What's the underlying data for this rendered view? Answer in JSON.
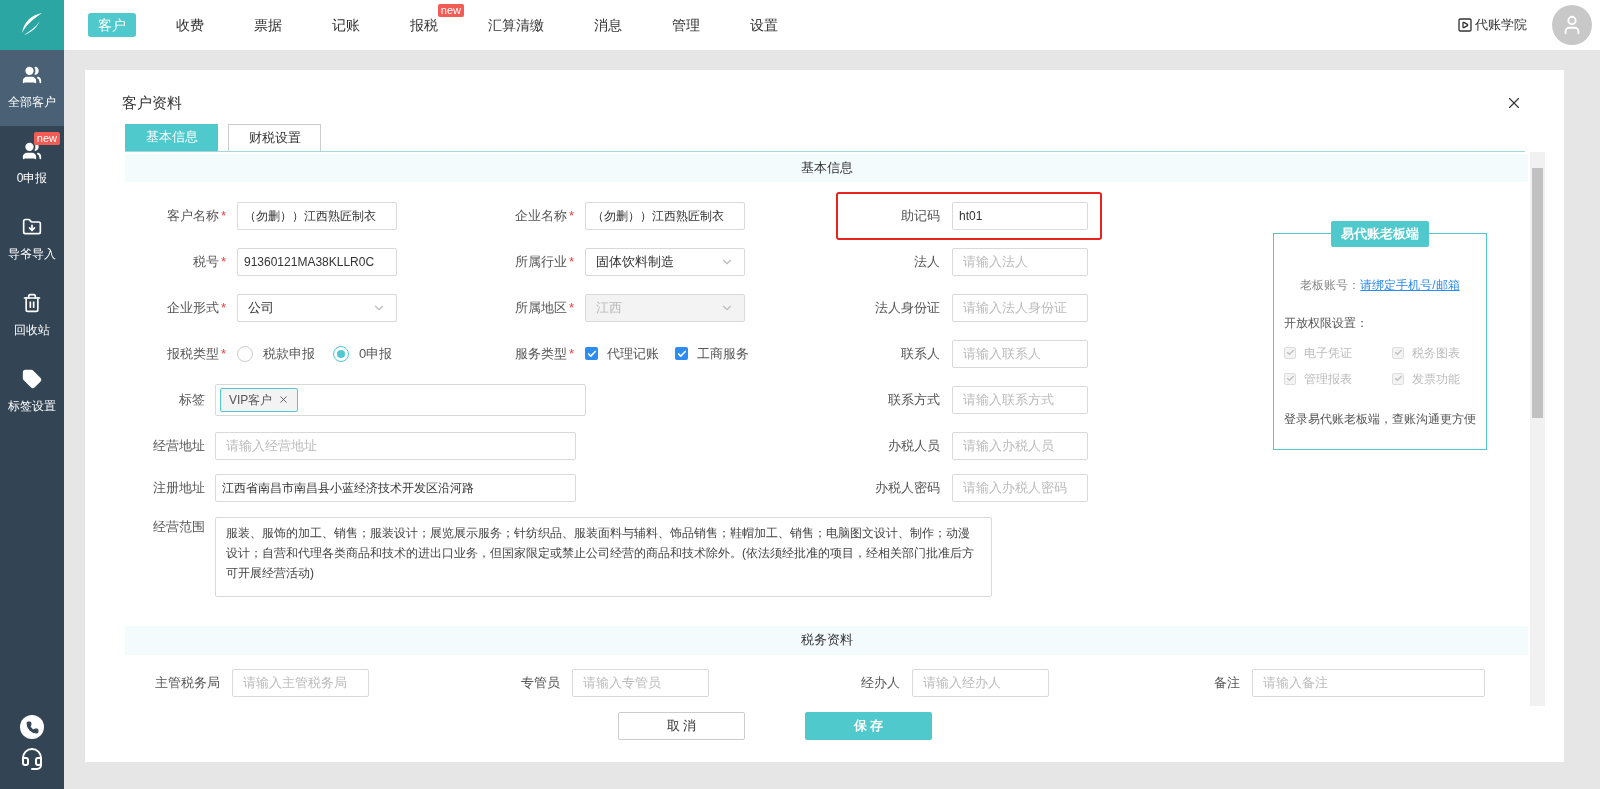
{
  "nav": {
    "items": [
      {
        "label": "客户",
        "selected": true
      },
      {
        "label": "收费",
        "selected": false
      },
      {
        "label": "票据",
        "selected": false
      },
      {
        "label": "记账",
        "selected": false
      },
      {
        "label": "报税",
        "selected": false,
        "badge": "new"
      },
      {
        "label": "汇算清缴",
        "selected": false
      },
      {
        "label": "消息",
        "selected": false
      },
      {
        "label": "管理",
        "selected": false
      },
      {
        "label": "设置",
        "selected": false
      }
    ],
    "academy": "代账学院"
  },
  "sidebar": {
    "items": [
      {
        "kind": "users",
        "label": "全部客户",
        "selected": true
      },
      {
        "kind": "users",
        "label": "0申报",
        "selected": false,
        "badge": "new"
      },
      {
        "kind": "import",
        "label": "导爷导入",
        "selected": false
      },
      {
        "kind": "trash",
        "label": "回收站",
        "selected": false
      },
      {
        "kind": "tag",
        "label": "标签设置",
        "selected": false
      }
    ]
  },
  "modal": {
    "title": "客户资料",
    "tabs": [
      {
        "label": "基本信息",
        "selected": true
      },
      {
        "label": "财税设置",
        "selected": false
      }
    ],
    "basic_section": "基本信息",
    "rows": [
      {
        "fields": [
          {
            "kind": "text",
            "label": "客户名称",
            "marker": "*",
            "value": "（勿删））江西熟匠制衣"
          },
          {
            "kind": "text",
            "label": "企业名称",
            "marker": "*",
            "value": "（勿删））江西熟匠制衣"
          },
          {
            "kind": "text",
            "label": "助记码",
            "value": "ht01",
            "highlighted": true
          }
        ]
      },
      {
        "fields": [
          {
            "kind": "text",
            "label": "税号",
            "marker": "*",
            "value": "91360121MA38KLLR0C"
          },
          {
            "kind": "select",
            "label": "所属行业",
            "marker": "*",
            "value": "固体饮料制造",
            "disabled": false
          },
          {
            "kind": "text",
            "label": "法人",
            "placeholder": "请输入法人"
          }
        ]
      },
      {
        "fields": [
          {
            "kind": "select",
            "label": "企业形式",
            "marker": "*",
            "value": "公司",
            "disabled": false
          },
          {
            "kind": "select",
            "label": "所属地区",
            "marker": "*",
            "value": "江西",
            "disabled": true
          },
          {
            "kind": "text",
            "label": "法人身份证",
            "placeholder": "请输入法人身份证"
          }
        ]
      },
      {
        "fields": [
          {
            "kind": "radio",
            "label": "报税类型",
            "marker": "*",
            "options": [
              {
                "label": "税款申报",
                "selected": false
              },
              {
                "label": "0申报",
                "selected": true
              }
            ]
          },
          {
            "kind": "checkbox",
            "label": "服务类型",
            "marker": "*",
            "options": [
              {
                "label": "代理记账",
                "checked": true
              },
              {
                "label": "工商服务",
                "checked": true
              }
            ]
          },
          {
            "kind": "text",
            "label": "联系人",
            "placeholder": "请输入联系人"
          }
        ]
      },
      {
        "fields": [
          {
            "kind": "tags",
            "label": "标签",
            "tags": [
              "VIP客户"
            ]
          },
          {
            "kind": "text",
            "label": "联系方式",
            "placeholder": "请输入联系方式"
          }
        ]
      },
      {
        "fields": [
          {
            "kind": "wide_text",
            "label": "经营地址",
            "placeholder": "请输入经营地址"
          },
          {
            "kind": "text",
            "label": "办税人员",
            "placeholder": "请输入办税人员"
          }
        ]
      },
      {
        "fields": [
          {
            "kind": "wide_text",
            "label": "注册地址",
            "value": "江西省南昌市南昌县小蓝经济技术开发区沿河路"
          },
          {
            "kind": "text",
            "label": "办税人密码",
            "placeholder": "请输入办税人密码"
          }
        ]
      },
      {
        "fields": [
          {
            "kind": "textarea",
            "label": "经营范围",
            "value": "服装、服饰的加工、销售；服装设计；展览展示服务；针纺织品、服装面料与辅料、饰品销售；鞋帽加工、销售；电脑图文设计、制作；动漫设计；自营和代理各类商品和技术的进出口业务，但国家限定或禁止公司经营的商品和技术除外。(依法须经批准的项目，经相关部门批准后方可开展经营活动)"
          }
        ]
      }
    ],
    "boss_panel": {
      "title": "易代账老板端",
      "account_label": "老板账号：",
      "account_link": "请绑定手机号/邮箱",
      "permissions_title": "开放权限设置：",
      "permissions": [
        {
          "label": "电子凭证",
          "checked": true,
          "disabled": true
        },
        {
          "label": "税务图表",
          "checked": true,
          "disabled": true
        },
        {
          "label": "管理报表",
          "checked": true,
          "disabled": true
        },
        {
          "label": "发票功能",
          "checked": true,
          "disabled": true
        }
      ],
      "footer": "登录易代账老板端，查账沟通更方便"
    },
    "tax_section": "税务资料",
    "tax_fields": [
      {
        "label": "主管税务局",
        "placeholder": "请输入主管税务局"
      },
      {
        "label": "专管员",
        "placeholder": "请输入专管员"
      },
      {
        "label": "经办人",
        "placeholder": "请输入经办人"
      },
      {
        "label": "备注",
        "placeholder": "请输入备注"
      }
    ],
    "buttons": [
      {
        "kind": "secondary",
        "label": "取 消"
      },
      {
        "kind": "primary",
        "label": "保 存"
      }
    ]
  }
}
